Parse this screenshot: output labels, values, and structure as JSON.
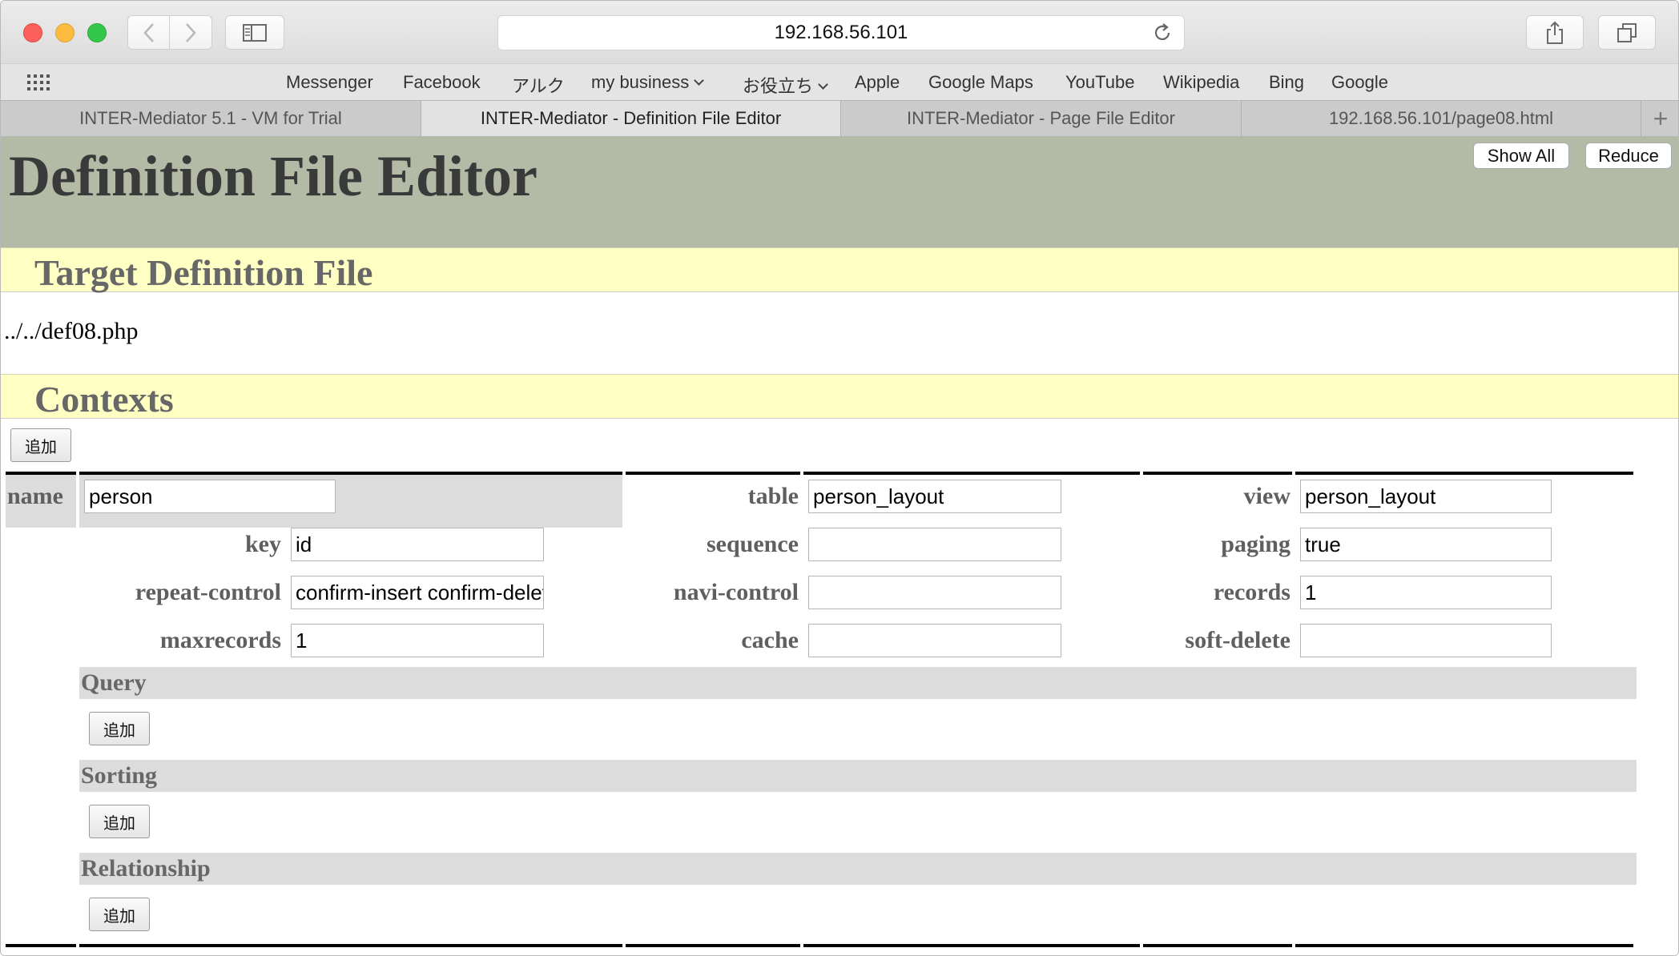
{
  "browser": {
    "url": "192.168.56.101",
    "bookmarks": [
      "Messenger",
      "Facebook",
      "アルク",
      "my business",
      "お役立ち",
      "Apple",
      "Google Maps",
      "YouTube",
      "Wikipedia",
      "Bing",
      "Google"
    ],
    "tabs": [
      {
        "label": "INTER-Mediator 5.1 - VM for Trial"
      },
      {
        "label": "INTER-Mediator - Definition File Editor"
      },
      {
        "label": "INTER-Mediator - Page File Editor"
      },
      {
        "label": "192.168.56.101/page08.html"
      }
    ]
  },
  "page": {
    "title": "Definition File Editor",
    "show_all_label": "Show All",
    "reduce_label": "Reduce",
    "target_heading": "Target Definition File",
    "target_path": "../../def08.php",
    "contexts_heading": "Contexts",
    "add_label": "追加",
    "context": {
      "name_label": "name",
      "name_value": "person",
      "table_label": "table",
      "table_value": "person_layout",
      "view_label": "view",
      "view_value": "person_layout",
      "key_label": "key",
      "key_value": "id",
      "sequence_label": "sequence",
      "sequence_value": "",
      "paging_label": "paging",
      "paging_value": "true",
      "repeat_control_label": "repeat-control",
      "repeat_control_value": "confirm-insert confirm-delete",
      "navi_control_label": "navi-control",
      "navi_control_value": "",
      "records_label": "records",
      "records_value": "1",
      "maxrecords_label": "maxrecords",
      "maxrecords_value": "1",
      "cache_label": "cache",
      "cache_value": "",
      "soft_delete_label": "soft-delete",
      "soft_delete_value": ""
    },
    "query_heading": "Query",
    "sorting_heading": "Sorting",
    "relationship_heading": "Relationship"
  },
  "colors": {
    "header_bg": "#b3bba6",
    "section_bg": "#ffffc4"
  }
}
